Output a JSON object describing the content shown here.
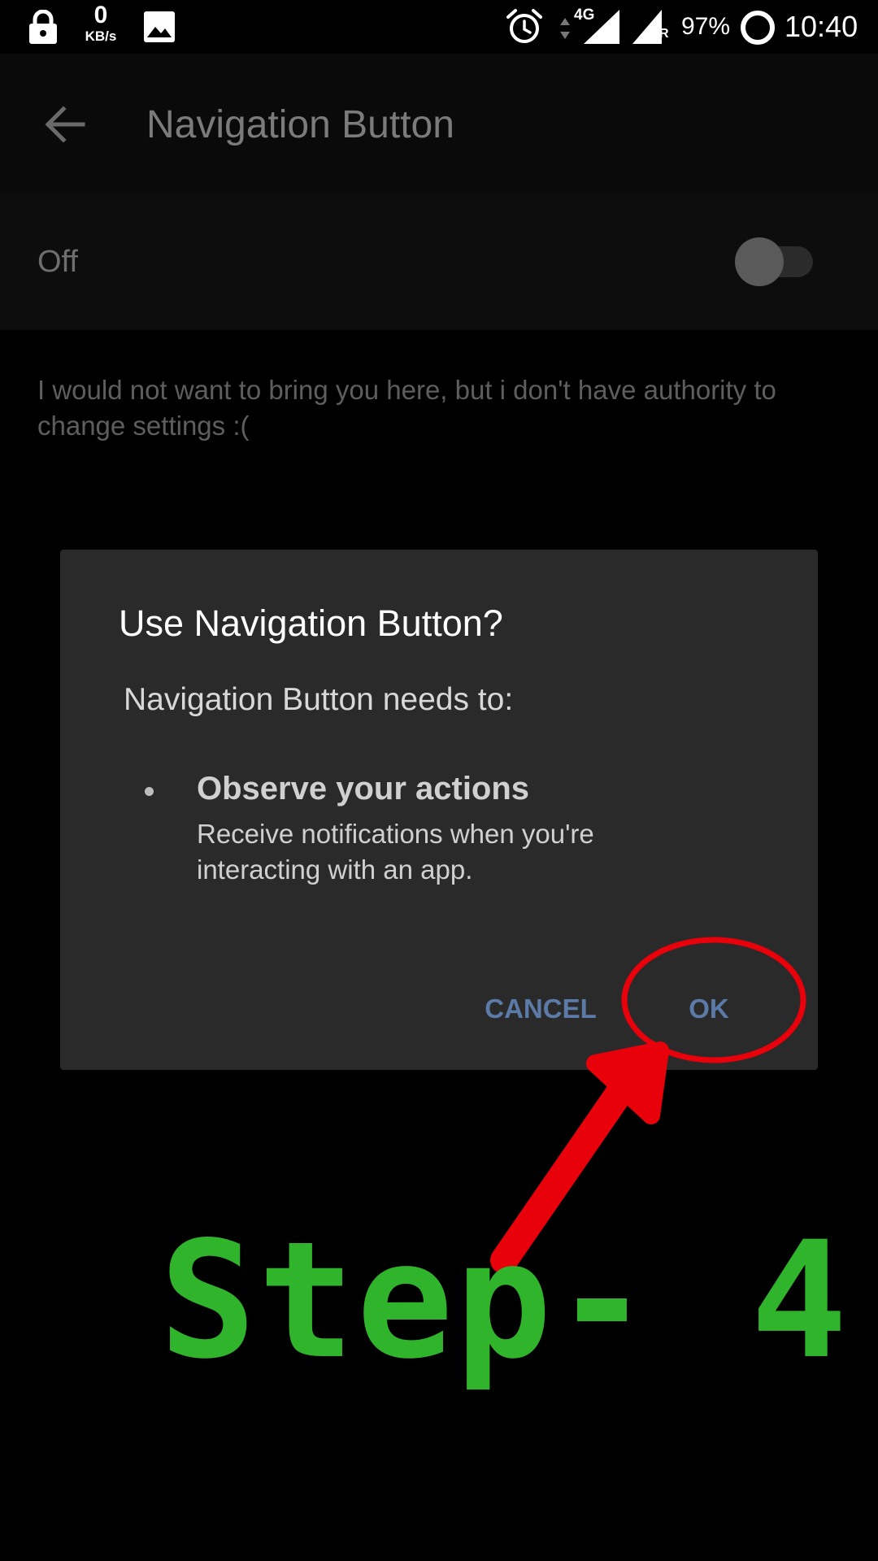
{
  "status_bar": {
    "speed_value": "0",
    "speed_unit": "KB/s",
    "network_type": "4G",
    "roaming_indicator": "R",
    "battery": "97%",
    "time": "10:40",
    "icons": [
      "lock-icon",
      "image-icon",
      "alarm-icon",
      "data-arrows-icon",
      "signal-icon",
      "signal-roaming-icon",
      "battery-ring-icon"
    ]
  },
  "app_bar": {
    "back_icon": "arrow-back-icon",
    "title": "Navigation Button"
  },
  "master_switch": {
    "label": "Off",
    "state": "off"
  },
  "description": "I would not want to bring you here, but i don't have authority to change settings :(",
  "dialog": {
    "title": "Use Navigation Button?",
    "subtitle": "Navigation Button needs to:",
    "permission": {
      "bullet": "•",
      "title": "Observe your actions",
      "description": "Receive notifications when you're interacting with an app."
    },
    "cancel_label": "CANCEL",
    "ok_label": "OK"
  },
  "annotation": {
    "step_label": "Step- 4",
    "highlight_color": "#e8000b",
    "text_color": "#30b42c"
  }
}
